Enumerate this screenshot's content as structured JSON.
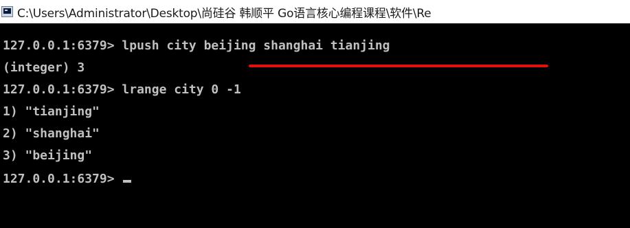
{
  "window": {
    "title": "C:\\Users\\Administrator\\Desktop\\尚硅谷 韩顺平 Go语言核心编程课程\\软件\\Re",
    "icon": "console-window-icon"
  },
  "console": {
    "lines": [
      "127.0.0.1:6379> lpush city beijing shanghai tianjing",
      "(integer) 3",
      "127.0.0.1:6379> lrange city 0 -1",
      "1) \"tianjing\"",
      "2) \"shanghai\"",
      "3) \"beijing\"",
      "127.0.0.1:6379> "
    ],
    "colors": {
      "background": "#000000",
      "text": "#c0c0c0",
      "annotation": "#e01010"
    }
  }
}
